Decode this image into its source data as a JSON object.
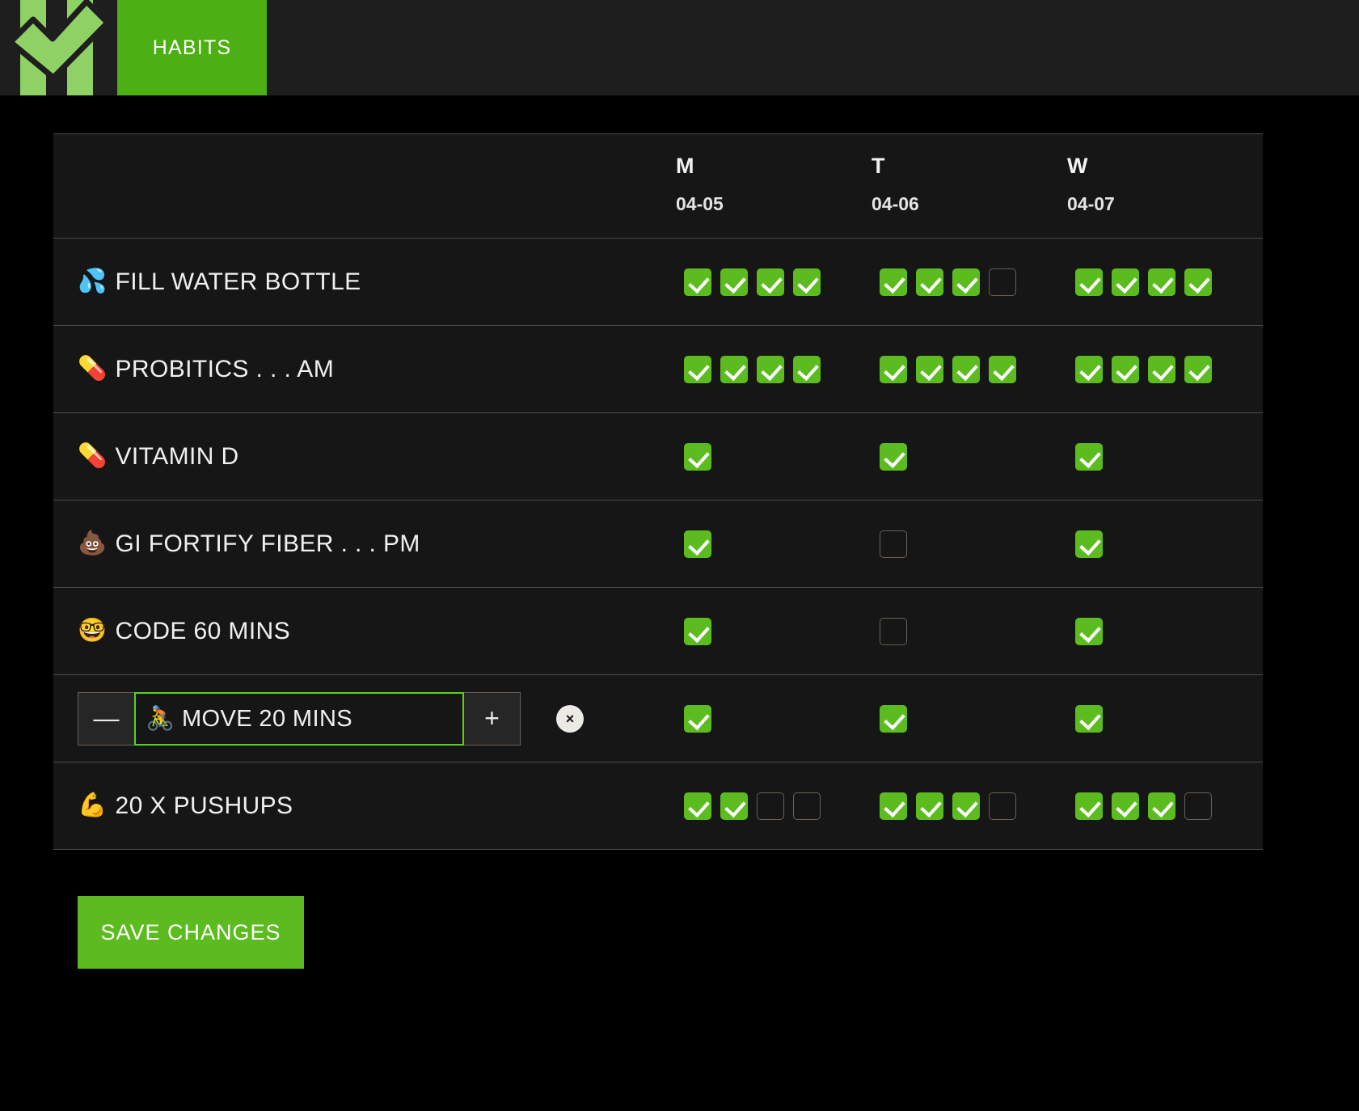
{
  "nav": {
    "logo_name": "checkmark-bars-logo",
    "tab_label": "HABITS"
  },
  "table": {
    "label_column_header": "",
    "days": [
      {
        "letter": "M",
        "date": "04-05"
      },
      {
        "letter": "T",
        "date": "04-06"
      },
      {
        "letter": "W",
        "date": "04-07"
      }
    ],
    "rows": [
      {
        "emoji": "💦",
        "emoji_name": "sweat-droplets-icon",
        "label": "FILL WATER BOTTLE",
        "editing": false,
        "checks": [
          [
            true,
            true,
            true,
            true
          ],
          [
            true,
            true,
            true,
            false
          ],
          [
            true,
            true,
            true,
            true
          ]
        ]
      },
      {
        "emoji": "💊",
        "emoji_name": "pill-icon",
        "label": "PROBITICS . . . AM",
        "editing": false,
        "checks": [
          [
            true,
            true,
            true,
            true
          ],
          [
            true,
            true,
            true,
            true
          ],
          [
            true,
            true,
            true,
            true
          ]
        ]
      },
      {
        "emoji": "💊",
        "emoji_name": "pill-icon",
        "label": "VITAMIN D",
        "editing": false,
        "checks": [
          [
            true
          ],
          [
            true
          ],
          [
            true
          ]
        ]
      },
      {
        "emoji": "💩",
        "emoji_name": "poop-icon",
        "label": "GI FORTIFY FIBER . . . PM",
        "editing": false,
        "checks": [
          [
            true
          ],
          [
            false
          ],
          [
            true
          ]
        ]
      },
      {
        "emoji": "🤓",
        "emoji_name": "nerd-face-icon",
        "label": "CODE 60 MINS",
        "editing": false,
        "checks": [
          [
            true
          ],
          [
            false
          ],
          [
            true
          ]
        ]
      },
      {
        "emoji": "🚴",
        "emoji_name": "cyclist-icon",
        "label": "🚴 MOVE 20 MINS",
        "editing": true,
        "minus_label": "—",
        "plus_label": "+",
        "delete_label": "×",
        "checks": [
          [
            true
          ],
          [
            true
          ],
          [
            true
          ]
        ]
      },
      {
        "emoji": "💪",
        "emoji_name": "flexed-biceps-icon",
        "label": "20 X PUSHUPS",
        "editing": false,
        "checks": [
          [
            true,
            true,
            false,
            false
          ],
          [
            true,
            true,
            true,
            false
          ],
          [
            true,
            true,
            true,
            false
          ]
        ]
      }
    ]
  },
  "footer": {
    "save_label": "SAVE CHANGES"
  },
  "colors": {
    "accent_green": "#5cbc1f",
    "tab_green": "#4caf13",
    "input_border_green": "#55d416",
    "panel_bg": "#161616",
    "page_bg": "#000000",
    "nav_bg": "#1e1e1e"
  }
}
